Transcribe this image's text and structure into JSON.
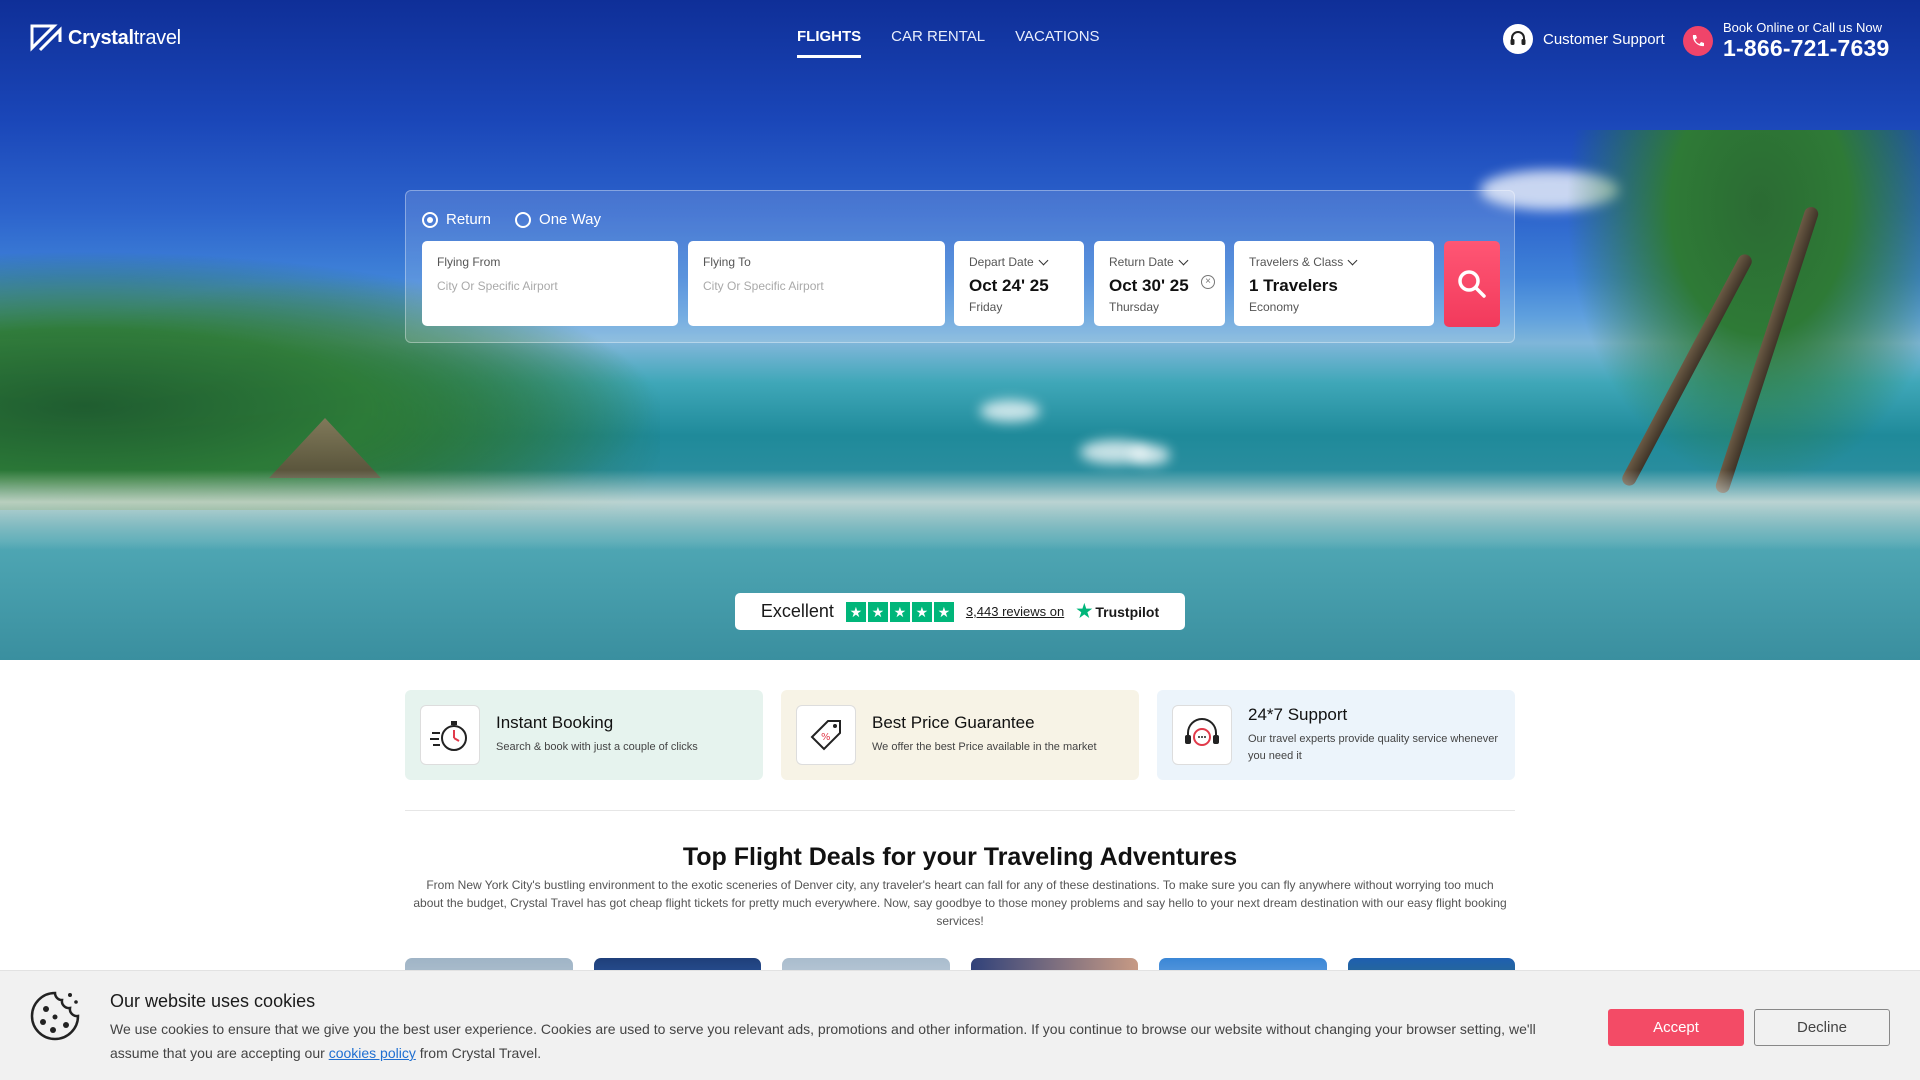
{
  "brand": {
    "name_bold": "Crystal",
    "name_light": "travel"
  },
  "nav": {
    "items": [
      {
        "label": "FLIGHTS",
        "active": true
      },
      {
        "label": "CAR RENTAL",
        "active": false
      },
      {
        "label": "VACATIONS",
        "active": false
      }
    ]
  },
  "support": {
    "label": "Customer Support"
  },
  "call": {
    "label": "Book Online or Call us Now",
    "number": "1-866-721-7639"
  },
  "search": {
    "trip_types": [
      {
        "label": "Return",
        "selected": true
      },
      {
        "label": "One Way",
        "selected": false
      }
    ],
    "flying_from": {
      "label": "Flying From",
      "placeholder": "City Or Specific Airport"
    },
    "flying_to": {
      "label": "Flying To",
      "placeholder": "City Or Specific Airport"
    },
    "depart": {
      "label": "Depart Date",
      "value": "Oct 24' 25",
      "day": "Friday"
    },
    "return": {
      "label": "Return Date",
      "value": "Oct 30' 25",
      "day": "Thursday"
    },
    "travelers": {
      "label": "Travelers & Class",
      "value": "1 Travelers",
      "class": "Economy"
    }
  },
  "trustpilot": {
    "rating_text": "Excellent",
    "stars": 5,
    "reviews": "3,443 reviews on",
    "brand": "Trustpilot"
  },
  "features": [
    {
      "title": "Instant Booking",
      "desc": "Search & book with just a couple of clicks",
      "bg": "#e6f3ee"
    },
    {
      "title": "Best Price Guarantee",
      "desc": "We offer the best Price available in the market",
      "bg": "#f7f3e6"
    },
    {
      "title": "24*7 Support",
      "desc": "Our travel experts provide quality service whenever you need it",
      "bg": "#ecf4fb"
    }
  ],
  "deals": {
    "title": "Top Flight Deals for your Traveling Adventures",
    "description": "From New York City's bustling environment to the exotic sceneries of Denver city, any traveler's heart can fall for any of these destinations. To make sure you can fly anywhere without worrying too much about the budget, Crystal Travel has got cheap flight tickets for pretty much everywhere. Now, say goodbye to those money problems and say hello to your next dream destination with our easy flight booking services!"
  },
  "cookie": {
    "title": "Our website uses cookies",
    "text_before": "We use cookies to ensure that we give you the best user experience. Cookies are used to serve you relevant ads, promotions and other information. If you continue to browse our website without changing your browser setting, we'll assume that you are accepting our",
    "link": "cookies policy",
    "text_after": "from Crystal Travel.",
    "accept": "Accept",
    "decline": "Decline"
  },
  "colors": {
    "accent": "#f34b66",
    "trust_green": "#00b67a",
    "link": "#1f6fd1"
  }
}
